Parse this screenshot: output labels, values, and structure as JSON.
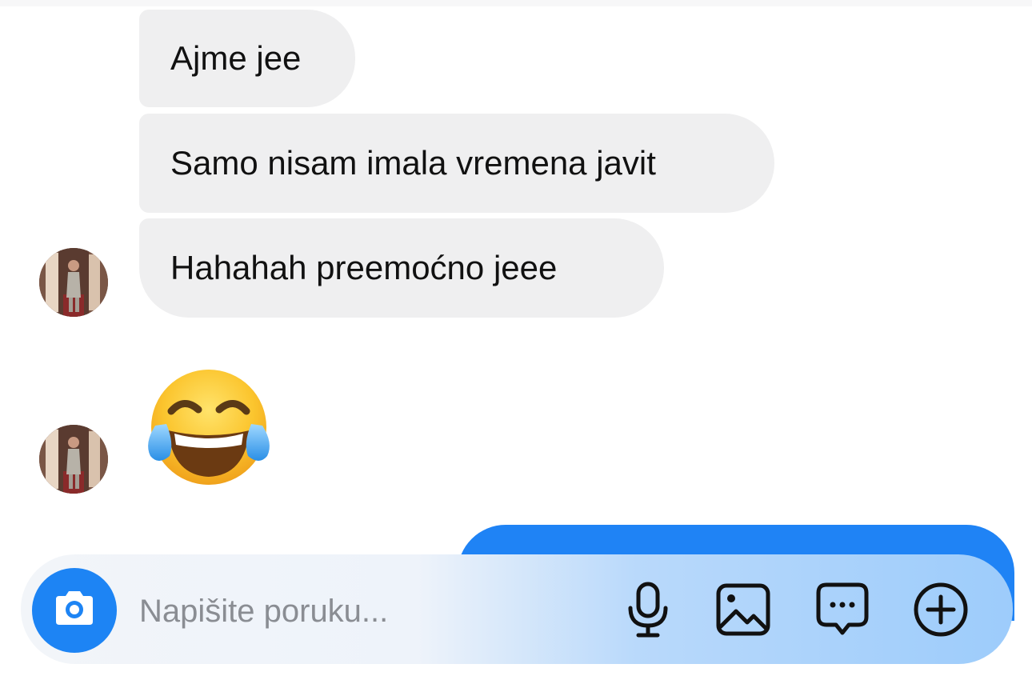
{
  "messages": [
    {
      "text": "Ajme jee"
    },
    {
      "text": "Samo nisam imala vremena javit"
    },
    {
      "text": "Hahahah preemoćno jeee"
    }
  ],
  "reaction_emoji": "face-with-tears-of-joy",
  "composer": {
    "placeholder": "Napišite poruku...",
    "icons": [
      "camera-icon",
      "microphone-icon",
      "image-icon",
      "message-dots-icon",
      "plus-circle-icon"
    ]
  },
  "colors": {
    "incoming_bubble": "#efeff0",
    "outgoing_bubble": "#1f83f5",
    "camera_button": "#1d84f4",
    "placeholder_text": "#8a8d93"
  }
}
